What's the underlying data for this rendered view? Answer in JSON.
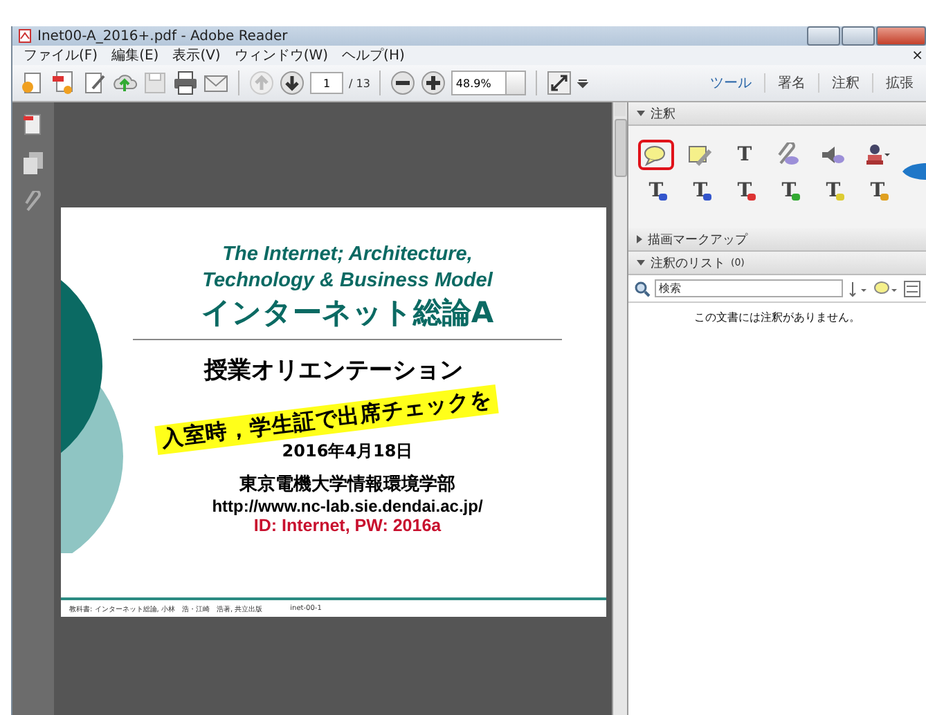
{
  "window": {
    "title": "Inet00-A_2016+.pdf - Adobe Reader"
  },
  "menu": [
    "ファイル(F)",
    "編集(E)",
    "表示(V)",
    "ウィンドウ(W)",
    "ヘルプ(H)"
  ],
  "menu_close": "×",
  "toolbar": {
    "page": "1",
    "page_count": "/ 13",
    "zoom": "48.9%",
    "panels": [
      "ツール",
      "署名",
      "注釈",
      "拡張"
    ]
  },
  "slide": {
    "title_en": "The Internet; Architecture,\nTechnology & Business Model",
    "title_ja": "インターネット総論A",
    "subtitle": "授業オリエンテーション",
    "banner": "入室時，学生証で出席チェックを",
    "date": "2016年4月18日",
    "department": "東京電機大学情報環境学部",
    "url": "http://www.nc-lab.sie.dendai.ac.jp/",
    "credentials": "ID: Internet, PW: 2016a",
    "footer": "教科書: インターネット総論, 小林　浩・江崎　浩著, 共立出版",
    "footer_code": "inet-00-1"
  },
  "comment_panel": {
    "sections": [
      {
        "label": "注釈",
        "expanded": true,
        "kind": "tools"
      },
      {
        "label": "描画マークアップ",
        "expanded": false,
        "kind": "plain"
      },
      {
        "label": "注釈のリスト",
        "count": "(0)",
        "expanded": true,
        "kind": "list"
      }
    ],
    "tools": [
      {
        "kind": "note",
        "selected": true
      },
      {
        "kind": "highlight",
        "selected": false
      },
      {
        "kind": "text",
        "glyph": "T",
        "selected": false
      },
      {
        "kind": "attach",
        "selected": false
      },
      {
        "kind": "audio",
        "selected": false
      },
      {
        "kind": "stamp",
        "selected": false
      },
      {
        "kind": "glyph",
        "glyph": "T",
        "color": "#3355cc",
        "selected": false
      },
      {
        "kind": "glyph",
        "glyph": "T",
        "color": "#3355cc",
        "selected": false
      },
      {
        "kind": "glyph",
        "glyph": "T",
        "color": "#dd3333",
        "selected": false
      },
      {
        "kind": "glyph",
        "glyph": "T",
        "color": "#33aa33",
        "selected": false
      },
      {
        "kind": "glyph",
        "glyph": "T",
        "color": "#ddcc33",
        "selected": false
      },
      {
        "kind": "glyph",
        "glyph": "T",
        "color": "#e0a020",
        "selected": false
      }
    ],
    "search": {
      "placeholder": "検索"
    },
    "empty_message": "この文書には注釈がありません。"
  }
}
